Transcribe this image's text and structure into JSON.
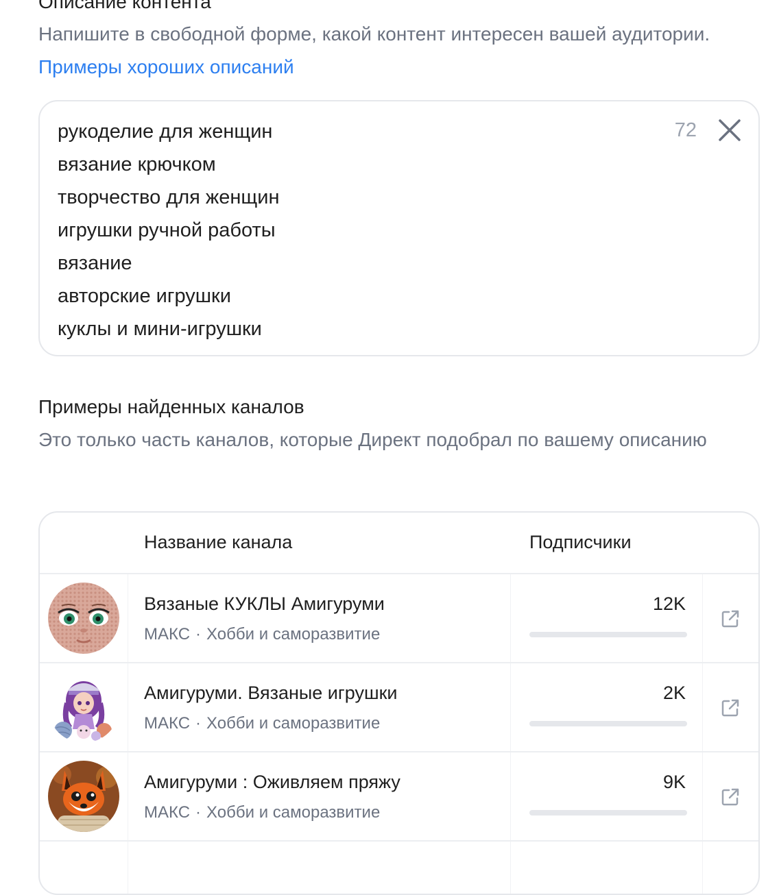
{
  "content_section": {
    "title": "Описание контента",
    "description": "Напишите в свободной форме, какой контент интересен вашей аудитории.",
    "link_label": "Примеры хороших описаний"
  },
  "textarea": {
    "lines": [
      "рукоделие для женщин",
      "вязание крючком",
      "творчество для женщин",
      "игрушки ручной работы",
      "вязание",
      "авторские игрушки",
      "куклы и мини-игрушки"
    ],
    "counter": "72",
    "clear_icon": "close-icon"
  },
  "channels_section": {
    "title": "Примеры найденных каналов",
    "description": "Это только часть каналов, которые Директ подобрал по вашему описанию"
  },
  "table": {
    "headers": {
      "name": "Название канала",
      "subscribers": "Подписчики"
    },
    "rows": [
      {
        "name": "Вязаные КУКЛЫ Амигуруми",
        "source": "МАКС",
        "dot": "·",
        "category": "Хобби и саморазвитие",
        "subscribers": "12K",
        "avatar_icon": "knitted-doll-face-avatar",
        "link_icon": "external-link-icon"
      },
      {
        "name": "Амигуруми. Вязаные игрушки",
        "source": "МАКС",
        "dot": "·",
        "category": "Хобби и саморазвитие",
        "subscribers": "2K",
        "avatar_icon": "girl-with-yarn-avatar",
        "link_icon": "external-link-icon"
      },
      {
        "name": "Амигуруми : Оживляем пряжу",
        "source": "МАКС",
        "dot": "·",
        "category": "Хобби и саморазвитие",
        "subscribers": "9K",
        "avatar_icon": "fox-avatar",
        "link_icon": "external-link-icon"
      }
    ]
  },
  "colors": {
    "link": "#2d7ff0",
    "muted_text": "#6b7280",
    "border": "#e5e7eb"
  }
}
